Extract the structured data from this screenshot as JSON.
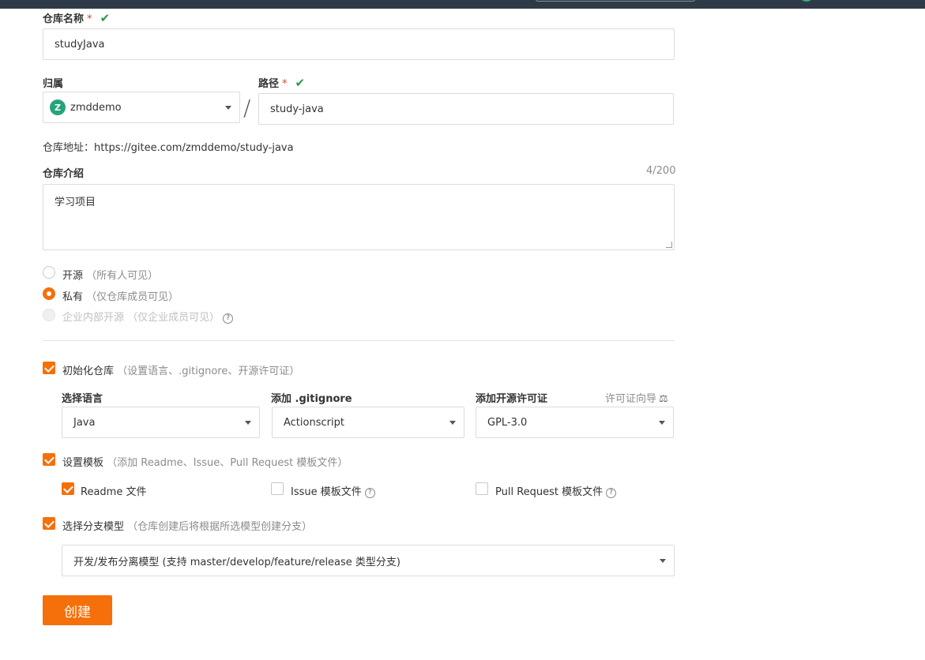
{
  "repo_name": {
    "label": "仓库名称",
    "required_mark": "*",
    "value": "studyJava"
  },
  "owner": {
    "label": "归属",
    "avatar_letter": "Z",
    "value": "zmddemo"
  },
  "path_separator": "/",
  "path": {
    "label": "路径",
    "required_mark": "*",
    "value": "study-java"
  },
  "repo_address": {
    "label": "仓库地址：",
    "url": "https://gitee.com/zmddemo/study-java"
  },
  "description": {
    "label": "仓库介绍",
    "counter": "4/200",
    "value": "学习项目"
  },
  "visibility": {
    "options": [
      {
        "label": "开源",
        "hint": "（所有人可见）",
        "state": "unchecked"
      },
      {
        "label": "私有",
        "hint": "（仅仓库成员可见）",
        "state": "checked"
      },
      {
        "label": "企业内部开源",
        "hint": "（仅企业成员可见）",
        "state": "disabled"
      }
    ]
  },
  "init_repo": {
    "label": "初始化仓库",
    "hint": "（设置语言、.gitignore、开源许可证）",
    "checked": true
  },
  "language": {
    "label": "选择语言",
    "value": "Java"
  },
  "gitignore": {
    "label": "添加 .gitignore",
    "value": "Actionscript"
  },
  "license": {
    "label": "添加开源许可证",
    "guide": "许可证向导",
    "value": "GPL-3.0"
  },
  "templates": {
    "label": "设置模板",
    "hint": "（添加 Readme、Issue、Pull Request 模板文件）",
    "checked": true,
    "items": [
      {
        "label": "Readme 文件",
        "checked": true
      },
      {
        "label": "Issue 模板文件",
        "checked": false
      },
      {
        "label": "Pull Request 模板文件",
        "checked": false
      }
    ]
  },
  "branch_model": {
    "label": "选择分支模型",
    "hint": "（仓库创建后将根据所选模型创建分支）",
    "checked": true,
    "value": "开发/发布分离模型 (支持 master/develop/feature/release 类型分支)"
  },
  "create_button": "创建",
  "colors": {
    "accent": "#f5700a",
    "success": "#2b9a4a",
    "required": "#e03b2f"
  }
}
